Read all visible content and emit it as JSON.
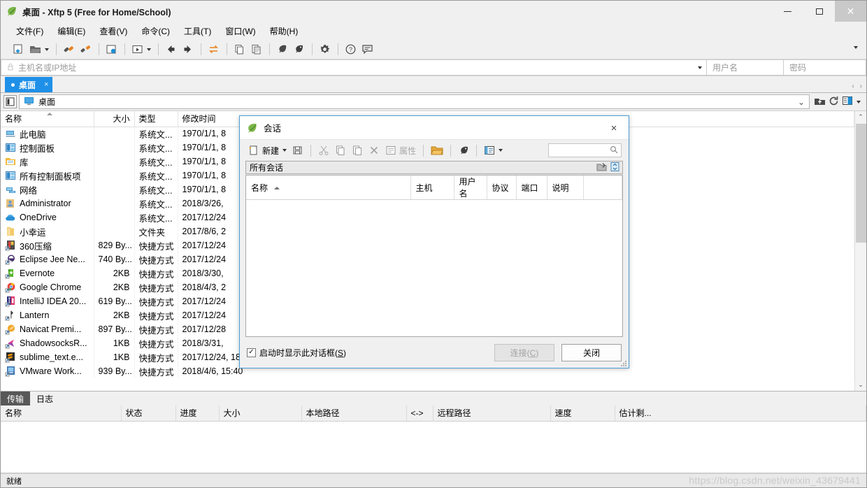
{
  "window": {
    "title": "桌面   - Xftp 5 (Free for Home/School)",
    "app_icon": "xftp-leaf-icon",
    "controls": {
      "minimize": "minimize-icon",
      "maximize": "maximize-icon",
      "close": "close-icon"
    }
  },
  "menubar": {
    "items": [
      {
        "label": "文件(F)",
        "name": "menu-file"
      },
      {
        "label": "编辑(E)",
        "name": "menu-edit"
      },
      {
        "label": "查看(V)",
        "name": "menu-view"
      },
      {
        "label": "命令(C)",
        "name": "menu-command"
      },
      {
        "label": "工具(T)",
        "name": "menu-tools"
      },
      {
        "label": "窗口(W)",
        "name": "menu-window"
      },
      {
        "label": "帮助(H)",
        "name": "menu-help"
      }
    ]
  },
  "toolbar": {
    "overflow": "toolbar-overflow-chevron"
  },
  "addressbar": {
    "host_placeholder": "主机名或IP地址",
    "user_placeholder": "用户名",
    "password_placeholder": "密码"
  },
  "tabstrip": {
    "tabs": [
      {
        "label": "桌面",
        "close": "×"
      }
    ],
    "nav_prev": "‹",
    "nav_next": "›"
  },
  "pathbar": {
    "path": "桌面"
  },
  "filelist": {
    "columns": [
      "名称",
      "大小",
      "类型",
      "修改时间"
    ],
    "rows": [
      {
        "name": "此电脑",
        "size": "",
        "type": "系统文...",
        "modified": "1970/1/1, 8",
        "icon": "computer-icon"
      },
      {
        "name": "控制面板",
        "size": "",
        "type": "系统文...",
        "modified": "1970/1/1, 8",
        "icon": "control-panel-icon"
      },
      {
        "name": "库",
        "size": "",
        "type": "系统文...",
        "modified": "1970/1/1, 8",
        "icon": "library-icon"
      },
      {
        "name": "所有控制面板项",
        "size": "",
        "type": "系统文...",
        "modified": "1970/1/1, 8",
        "icon": "control-panel-icon"
      },
      {
        "name": "网络",
        "size": "",
        "type": "系统文...",
        "modified": "1970/1/1, 8",
        "icon": "network-icon"
      },
      {
        "name": "Administrator",
        "size": "",
        "type": "系统文...",
        "modified": "2018/3/26,",
        "icon": "user-folder-icon"
      },
      {
        "name": "OneDrive",
        "size": "",
        "type": "系统文...",
        "modified": "2017/12/24",
        "icon": "onedrive-cloud-icon"
      },
      {
        "name": "小幸运",
        "size": "",
        "type": "文件夹",
        "modified": "2017/8/6, 2",
        "icon": "folder-icon"
      },
      {
        "name": "360压缩",
        "size": "829 By...",
        "type": "快捷方式",
        "modified": "2017/12/24",
        "icon": "360zip-shortcut-icon"
      },
      {
        "name": "Eclipse Jee Ne...",
        "size": "740 By...",
        "type": "快捷方式",
        "modified": "2017/12/24",
        "icon": "eclipse-shortcut-icon"
      },
      {
        "name": "Evernote",
        "size": "2KB",
        "type": "快捷方式",
        "modified": "2018/3/30,",
        "icon": "evernote-shortcut-icon"
      },
      {
        "name": "Google Chrome",
        "size": "2KB",
        "type": "快捷方式",
        "modified": "2018/4/3, 2",
        "icon": "chrome-shortcut-icon"
      },
      {
        "name": "IntelliJ IDEA 20...",
        "size": "619 By...",
        "type": "快捷方式",
        "modified": "2017/12/24",
        "icon": "intellij-shortcut-icon"
      },
      {
        "name": "Lantern",
        "size": "2KB",
        "type": "快捷方式",
        "modified": "2017/12/24",
        "icon": "lantern-shortcut-icon"
      },
      {
        "name": "Navicat Premi...",
        "size": "897 By...",
        "type": "快捷方式",
        "modified": "2017/12/28",
        "icon": "navicat-shortcut-icon"
      },
      {
        "name": "ShadowsocksR...",
        "size": "1KB",
        "type": "快捷方式",
        "modified": "2018/3/31,",
        "icon": "shadowsocksr-shortcut-icon"
      },
      {
        "name": "sublime_text.e...",
        "size": "1KB",
        "type": "快捷方式",
        "modified": "2017/12/24, 18:38",
        "icon": "sublime-shortcut-icon"
      },
      {
        "name": "VMware Work...",
        "size": "939 By...",
        "type": "快捷方式",
        "modified": "2018/4/6, 15:40",
        "icon": "vmware-shortcut-icon"
      }
    ]
  },
  "transfer": {
    "tabs": [
      {
        "label": "传输",
        "active": true
      },
      {
        "label": "日志",
        "active": false
      }
    ],
    "columns": [
      "名称",
      "状态",
      "进度",
      "大小",
      "本地路径",
      "<->",
      "远程路径",
      "速度",
      "估计剩..."
    ],
    "rows": []
  },
  "statusbar": {
    "text": "就绪",
    "watermark": "https://blog.csdn.net/weixin_43679441"
  },
  "dialog": {
    "title": "会话",
    "icon": "xftp-leaf-icon",
    "close": "×",
    "toolbar": {
      "new_label": "新建",
      "properties_label": "属性",
      "search_placeholder": ""
    },
    "filter_label": "所有会话",
    "columns": [
      "名称",
      "主机",
      "用户名",
      "协议",
      "端口",
      "说明"
    ],
    "rows": [],
    "footer": {
      "checkbox_label_pre": "启动时显示此对话框(",
      "checkbox_accel": "S",
      "checkbox_label_post": ")",
      "checkbox_checked": true,
      "connect_label_pre": "连接(",
      "connect_accel": "C",
      "connect_label_post": ")",
      "connect_enabled": false,
      "close_label": "关闭"
    }
  },
  "colors": {
    "accent_tab": "#1e90e8",
    "dialog_border": "#4c9ed9",
    "chrome": "#f0f0f0",
    "active_xfer_tab": "#585858"
  }
}
